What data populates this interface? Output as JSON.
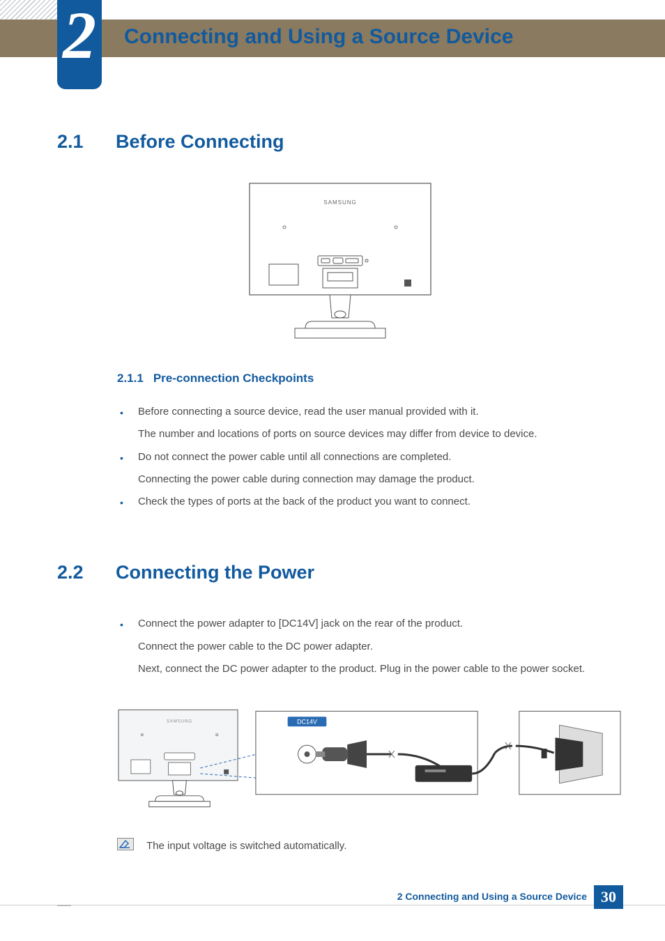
{
  "chapter": {
    "number": "2",
    "title": "Connecting and Using a Source Device"
  },
  "section_2_1": {
    "num": "2.1",
    "title": "Before Connecting",
    "sub": {
      "num": "2.1.1",
      "title": "Pre-connection Checkpoints"
    },
    "bullets": {
      "b1_line1": "Before connecting a source device, read the user manual provided with it.",
      "b1_line2": "The number and locations of ports on source devices may differ from device to device.",
      "b2_line1": "Do not connect the power cable until all connections are completed.",
      "b2_line2": "Connecting the power cable during connection may damage the product.",
      "b3_line1": "Check the types of ports at the back of the product you want to connect."
    }
  },
  "section_2_2": {
    "num": "2.2",
    "title": "Connecting the Power",
    "bullets": {
      "b1_line1": "Connect the power adapter to [DC14V] jack on the rear of the product.",
      "b1_line2": "Connect the power cable to the DC power adapter.",
      "b1_line3": "Next, connect the DC power adapter to the product. Plug in the power cable to the power socket."
    },
    "note": "The input voltage is switched automatically."
  },
  "diagram": {
    "brand": "SAMSUNG",
    "port_label": "DC14V"
  },
  "footer": {
    "text": "2 Connecting and Using a Source Device",
    "page": "30"
  }
}
